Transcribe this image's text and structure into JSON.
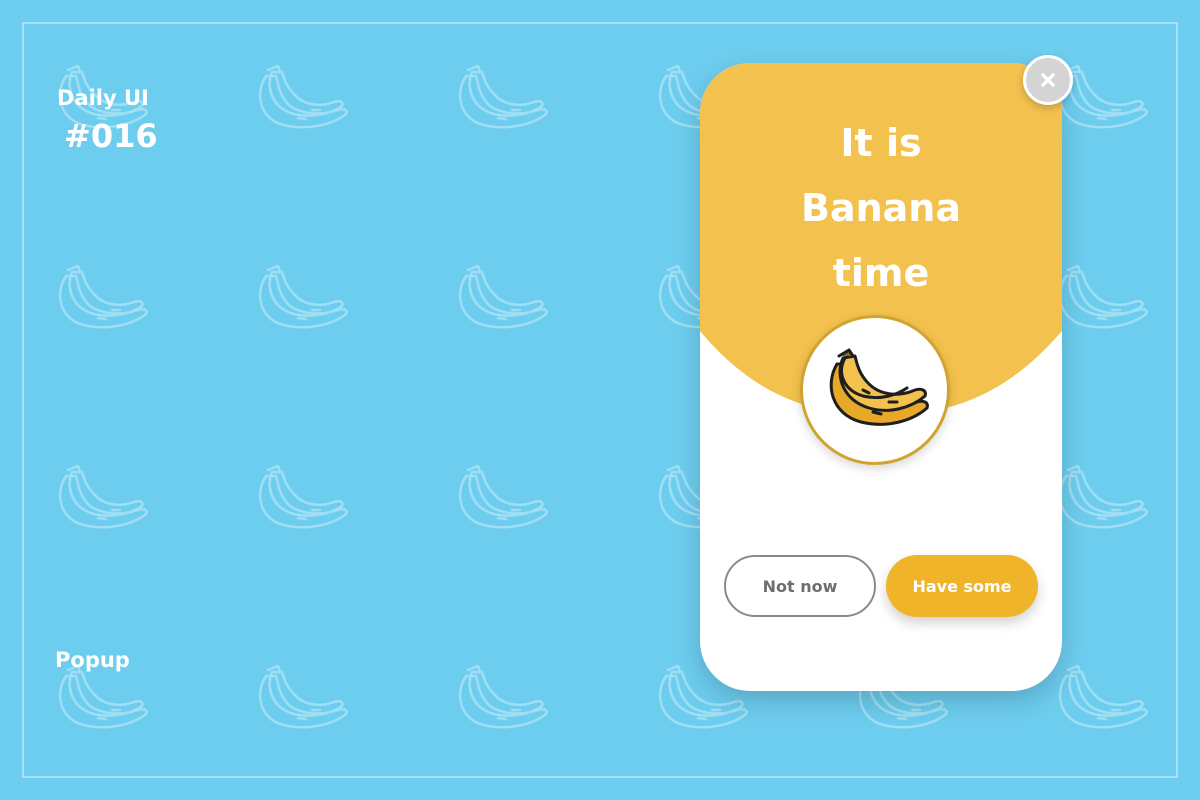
{
  "branding": {
    "label": "Daily UI",
    "number": "#016"
  },
  "caption": "Popup",
  "popup": {
    "title_lines": [
      "It is",
      "Banana",
      "time"
    ],
    "icon": "banana-icon",
    "secondary_button": "Not now",
    "primary_button": "Have some",
    "close_icon": "close-icon"
  },
  "colors": {
    "background": "#6dcdef",
    "popup_header": "#f2c14e",
    "primary_button": "#f0b42a",
    "close_button": "#d4d4d4"
  }
}
